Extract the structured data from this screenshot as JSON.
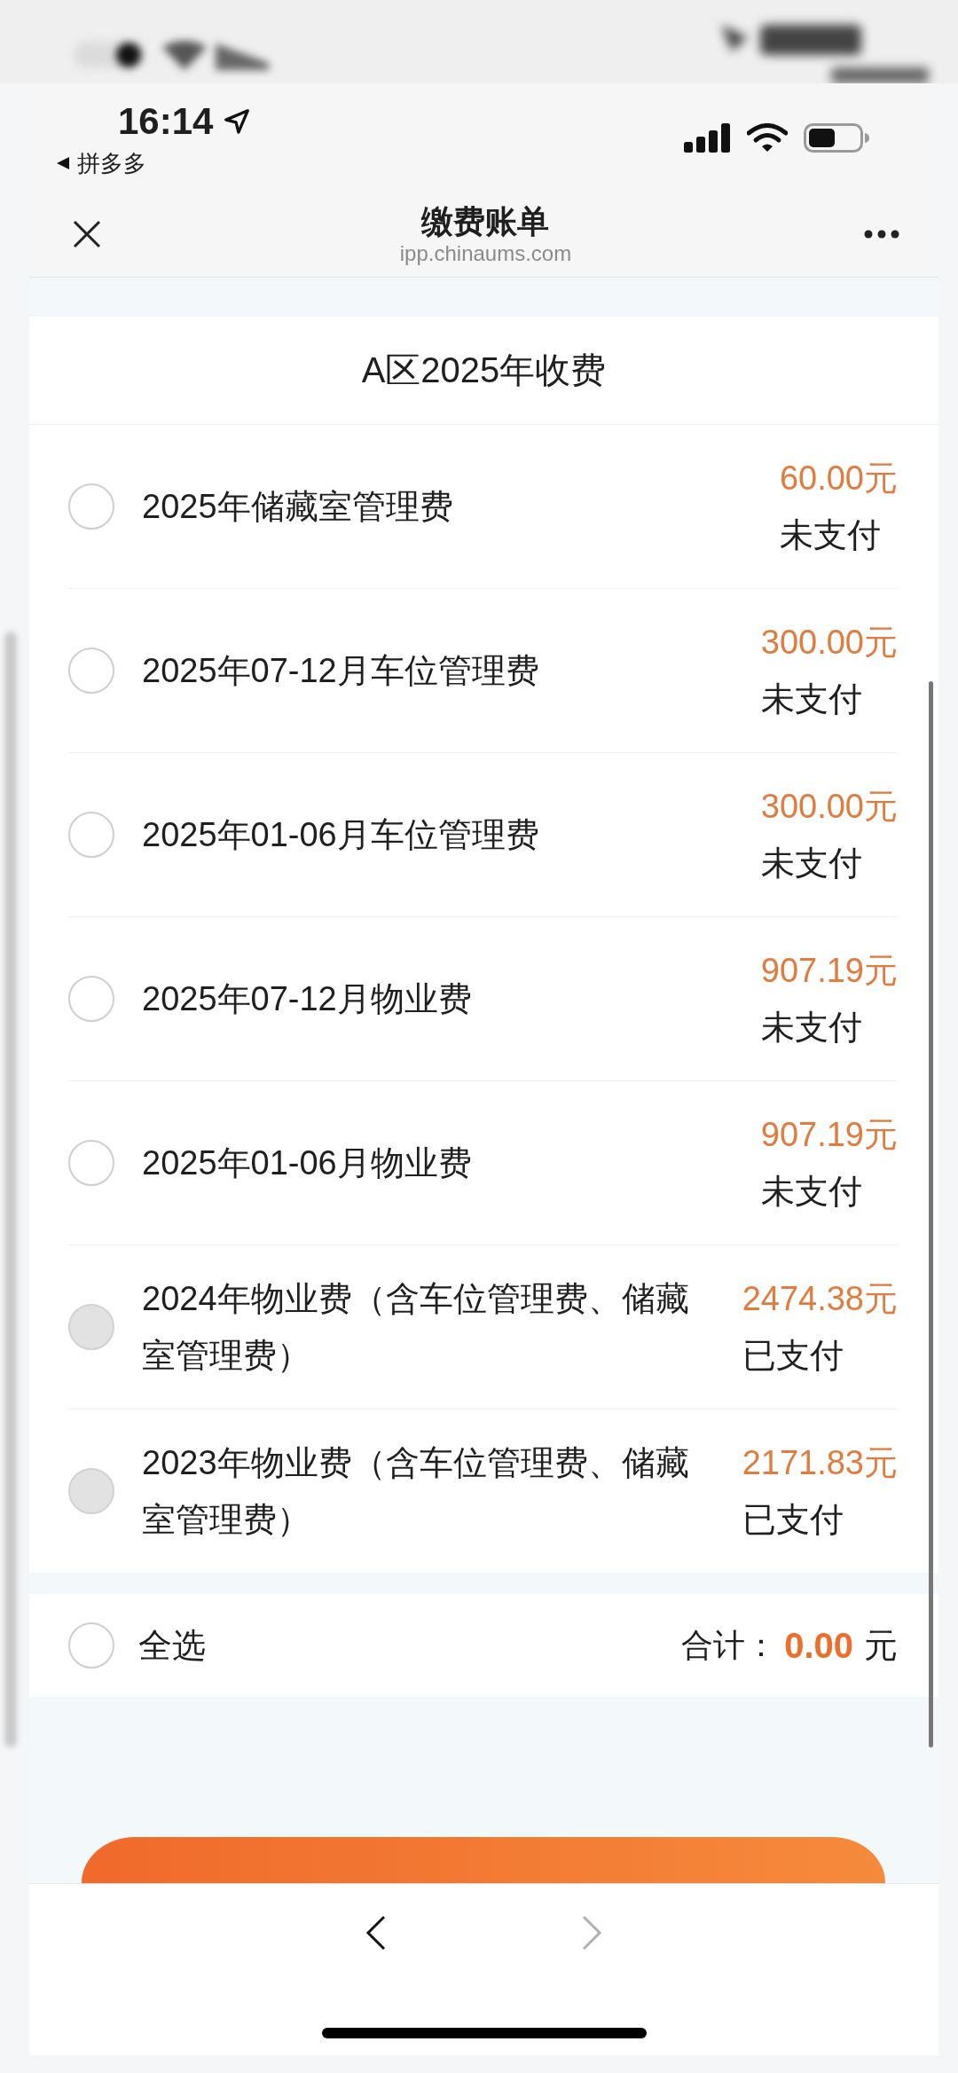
{
  "status_bar": {
    "time": "16:14",
    "back_to_app": "拼多多"
  },
  "nav_bar": {
    "title": "缴费账单",
    "url": "ipp.chinaums.com"
  },
  "bill_group": {
    "title": "A区2025年收费",
    "items": [
      {
        "name": "2025年储藏室管理费",
        "amount": "60.00元",
        "status": "未支付",
        "selected": false,
        "disabled": false
      },
      {
        "name": "2025年07-12月车位管理费",
        "amount": "300.00元",
        "status": "未支付",
        "selected": false,
        "disabled": false
      },
      {
        "name": "2025年01-06月车位管理费",
        "amount": "300.00元",
        "status": "未支付",
        "selected": false,
        "disabled": false
      },
      {
        "name": "2025年07-12月物业费",
        "amount": "907.19元",
        "status": "未支付",
        "selected": false,
        "disabled": false
      },
      {
        "name": "2025年01-06月物业费",
        "amount": "907.19元",
        "status": "未支付",
        "selected": false,
        "disabled": false
      },
      {
        "name": "2024年物业费（含车位管理费、储藏室管理费）",
        "amount": "2474.38元",
        "status": "已支付",
        "selected": false,
        "disabled": true
      },
      {
        "name": "2023年物业费（含车位管理费、储藏室管理费）",
        "amount": "2171.83元",
        "status": "已支付",
        "selected": false,
        "disabled": true
      }
    ]
  },
  "footer": {
    "select_all": {
      "label": "全选",
      "selected": false
    },
    "total_label": "合计：",
    "total_value": "0.00",
    "total_unit": "元"
  },
  "browser_toolbar": {
    "back": {
      "disabled": false
    },
    "forward": {
      "disabled": true
    }
  }
}
